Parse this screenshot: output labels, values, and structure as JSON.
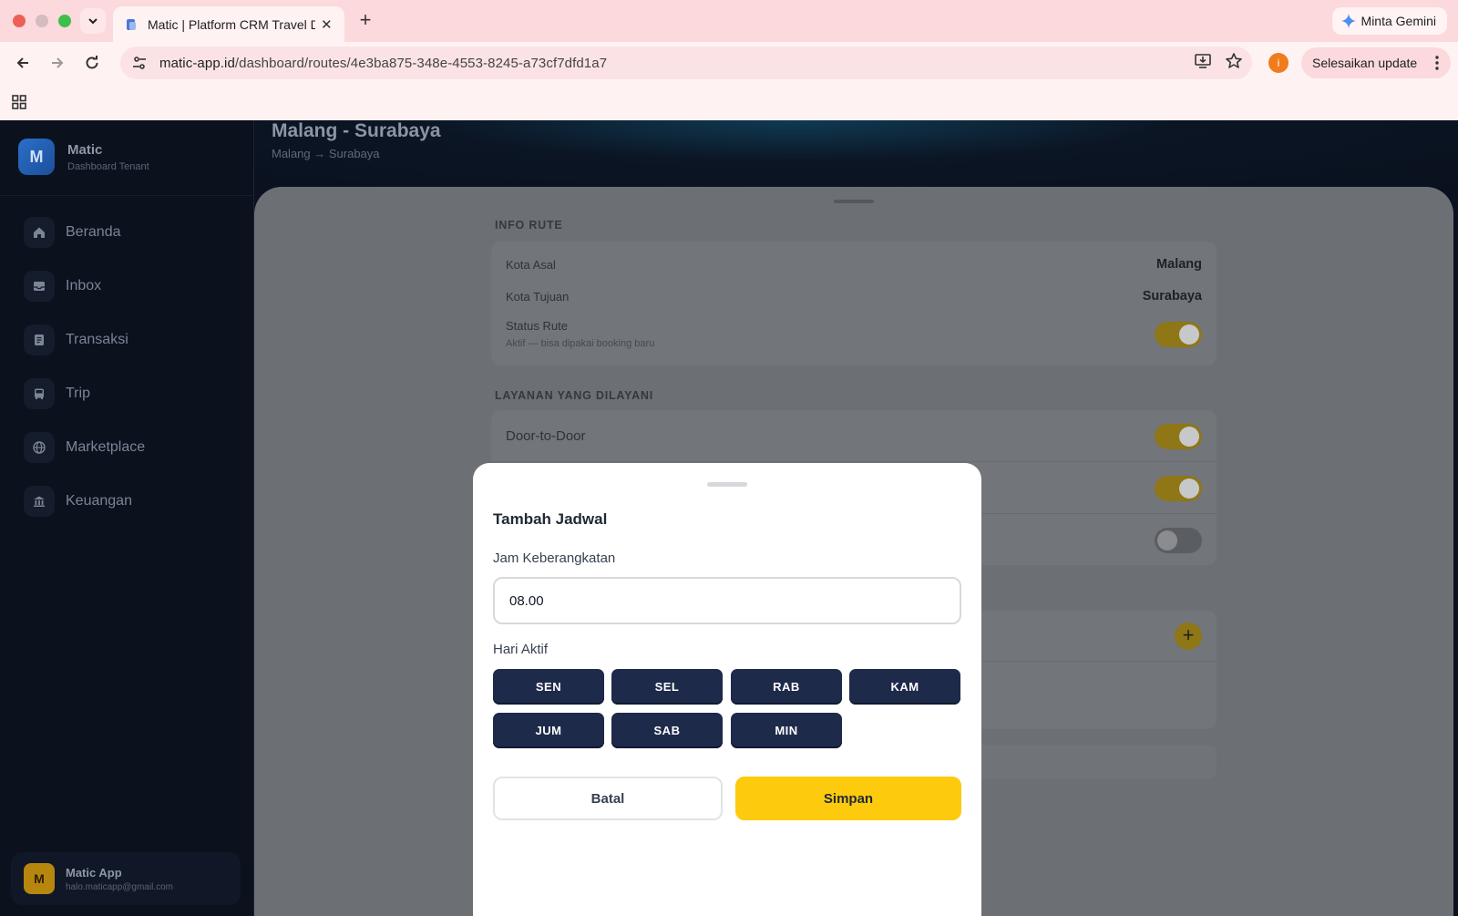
{
  "browser": {
    "tab_title": "Matic | Platform CRM Travel D",
    "new_tab_symbol": "+",
    "close_symbol": "✕",
    "gemini_label": "Minta Gemini",
    "url_host": "matic-app.id",
    "url_path": "/dashboard/routes/4e3ba875-348e-4553-8245-a73cf7dfd1a7",
    "extension_badge": "i",
    "update_label": "Selesaikan update",
    "colors": {
      "chrome": "#fbd9dc",
      "toolbar": "#fff2f3"
    }
  },
  "sidebar": {
    "brand_initial": "M",
    "brand_name": "Matic",
    "brand_subtitle": "Dashboard Tenant",
    "items": [
      {
        "label": "Beranda",
        "icon": "home-icon"
      },
      {
        "label": "Inbox",
        "icon": "inbox-icon"
      },
      {
        "label": "Transaksi",
        "icon": "receipt-icon"
      },
      {
        "label": "Trip",
        "icon": "bus-icon"
      },
      {
        "label": "Marketplace",
        "icon": "globe-icon"
      },
      {
        "label": "Keuangan",
        "icon": "bank-icon"
      }
    ],
    "user": {
      "initial": "M",
      "name": "Matic App",
      "email": "halo.maticapp@gmail.com"
    }
  },
  "header": {
    "title": "Malang - Surabaya",
    "subtitle": "Malang → Surabaya"
  },
  "info_rute": {
    "section_title": "INFO RUTE",
    "kota_asal_label": "Kota Asal",
    "kota_asal_value": "Malang",
    "kota_tujuan_label": "Kota Tujuan",
    "kota_tujuan_value": "Surabaya",
    "status_label": "Status Rute",
    "status_hint": "Aktif — bisa dipakai booking baru",
    "status_on": true
  },
  "layanan": {
    "section_title": "LAYANAN YANG DILAYANI",
    "first_service": "Door-to-Door",
    "toggles": [
      true,
      true,
      false
    ]
  },
  "modal": {
    "title": "Tambah Jadwal",
    "time_label": "Jam Keberangkatan",
    "time_value": "08.00",
    "days_label": "Hari Aktif",
    "days": [
      "SEN",
      "SEL",
      "RAB",
      "KAM",
      "JUM",
      "SAB",
      "MIN"
    ],
    "cancel_label": "Batal",
    "save_label": "Simpan",
    "colors": {
      "day_selected": "#1e2a4a",
      "save": "#fdca0e"
    }
  }
}
